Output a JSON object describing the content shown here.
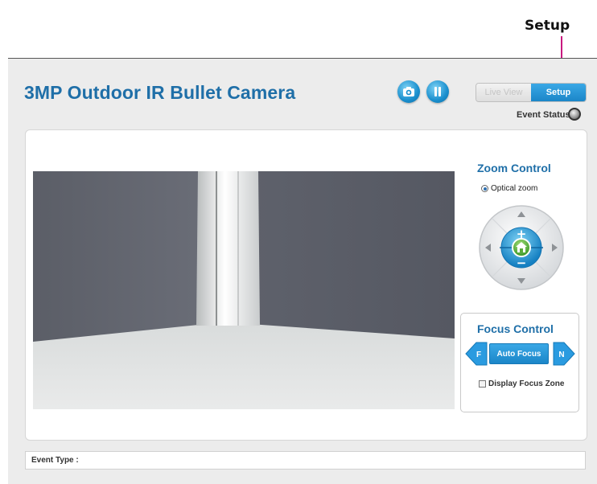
{
  "annotation": {
    "label": "Setup",
    "color": "#c8197f"
  },
  "app": {
    "title": "3MP Outdoor IR Bullet Camera"
  },
  "toolbar": {
    "snapshot_icon": "camera-icon",
    "pause_icon": "pause-icon"
  },
  "view_tabs": [
    {
      "label": "Live View",
      "active": false
    },
    {
      "label": "Setup",
      "active": true
    }
  ],
  "event_status": {
    "label": "Event Status :"
  },
  "zoom": {
    "title": "Zoom Control",
    "mode_label": "Optical zoom",
    "mode_selected": true,
    "pad_center_icon": "home-icon",
    "plus": "+",
    "minus": "−"
  },
  "focus": {
    "title": "Focus Control",
    "near_label": "F",
    "far_label": "N",
    "auto_label": "Auto Focus",
    "zone_label": "Display Focus Zone",
    "zone_checked": false
  },
  "event_type": {
    "label": "Event Type :"
  },
  "colors": {
    "accent": "#1f6fa8",
    "button_blue": "#1b86c8",
    "background": "#ececec"
  }
}
